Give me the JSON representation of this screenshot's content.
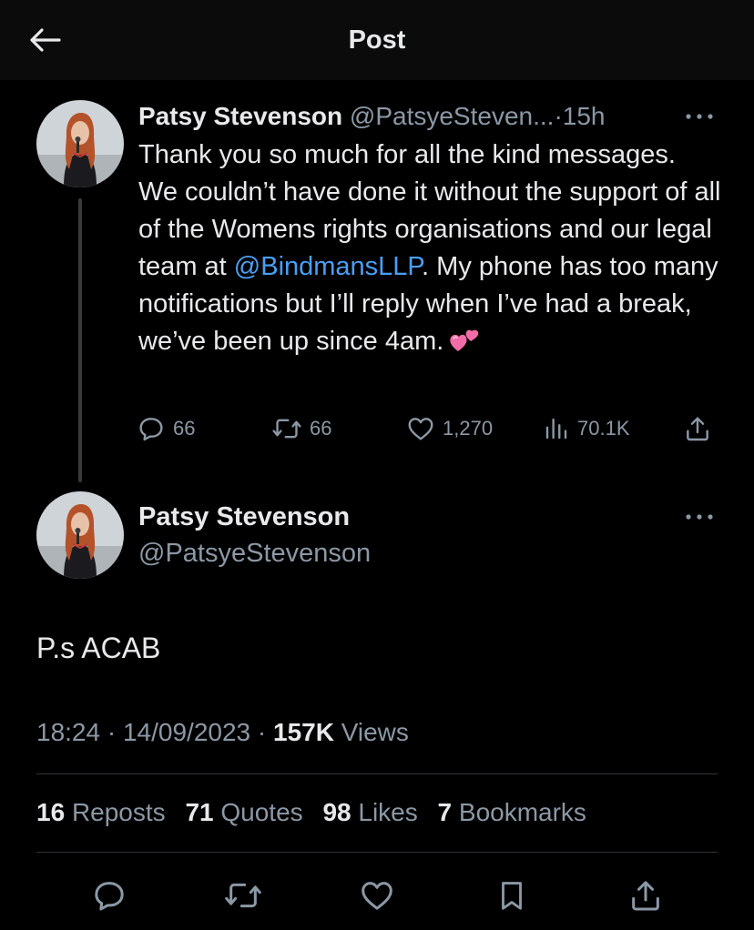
{
  "header": {
    "title": "Post",
    "back_icon": "arrow-left-icon"
  },
  "colors": {
    "background": "#000000",
    "header_background": "#0b0b0b",
    "text_primary": "#e7e9ea",
    "text_secondary": "#8b98a5",
    "mention": "#4a9ff5",
    "thread_line": "#3a3a3a"
  },
  "tweet1": {
    "name": "Patsy Stevenson",
    "handle": "@PatsyeSteven...",
    "separator": "·",
    "time": "15h",
    "text_before_mention": "Thank you so much for all the kind messages. We couldn’t have done it without the support of all of the Womens rights organisations and our legal team at ",
    "mention": "@BindmansLLP",
    "text_after_mention": ". My phone has too many notifications but I’ll reply when I’ve had a break, we’ve been up since 4am.",
    "emoji": "two-hearts-emoji",
    "actions": {
      "replies": "66",
      "reposts": "66",
      "likes": "1,270",
      "views": "70.1K"
    }
  },
  "tweet2": {
    "name": "Patsy Stevenson",
    "handle": "@PatsyeStevenson",
    "text": "P.s ACAB",
    "time": "18:24",
    "separator": "·",
    "date": "14/09/2023",
    "views_count": "157K",
    "views_label": "Views"
  },
  "stats": {
    "reposts_count": "16",
    "reposts_label": "Reposts",
    "quotes_count": "71",
    "quotes_label": "Quotes",
    "likes_count": "98",
    "likes_label": "Likes",
    "bookmarks_count": "7",
    "bookmarks_label": "Bookmarks"
  },
  "bottom_actions": [
    "reply-icon",
    "repost-icon",
    "like-icon",
    "bookmark-icon",
    "share-icon"
  ]
}
